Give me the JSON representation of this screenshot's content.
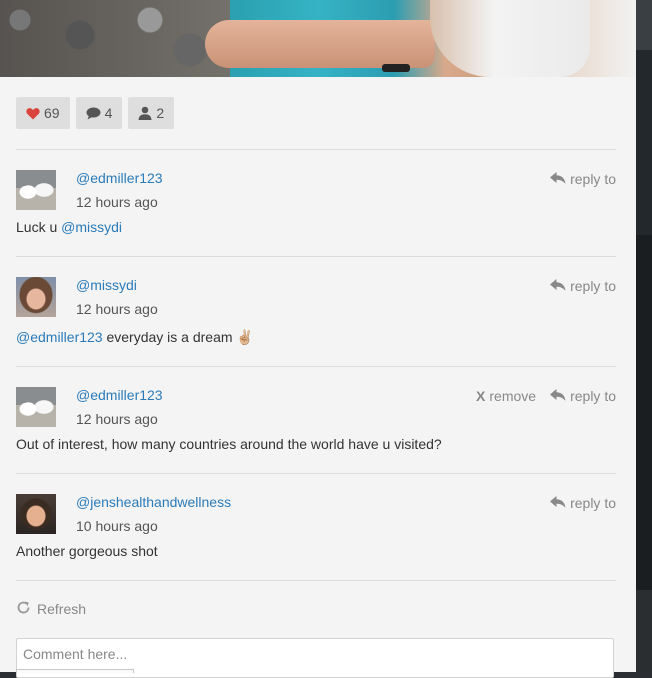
{
  "stats": {
    "likes": "69",
    "comments": "4",
    "followers": "2",
    "heart_color": "#d9443c"
  },
  "comments": [
    {
      "username": "@edmiller123",
      "time": "12 hours ago",
      "text_before": "Luck u ",
      "mention": "@missydi",
      "text_after": "",
      "reply_label": "reply to",
      "avatar": "dogs-avatar"
    },
    {
      "username": "@missydi",
      "time": "12 hours ago",
      "mention": "@edmiller123",
      "text_after": " everyday is a dream ✌🏼",
      "reply_label": "reply to",
      "avatar": "woman-avatar"
    },
    {
      "username": "@edmiller123",
      "time": "12 hours ago",
      "text": "Out of interest, how many countries around the world have u visited?",
      "remove_label": "remove",
      "reply_label": "reply to",
      "avatar": "dogs-avatar"
    },
    {
      "username": "@jenshealthandwellness",
      "time": "10 hours ago",
      "text": "Another gorgeous shot",
      "reply_label": "reply to",
      "avatar": "woman-avatar"
    }
  ],
  "refresh_label": "Refresh",
  "comment_input": {
    "placeholder": "Comment here...",
    "value": ""
  },
  "colors": {
    "link": "#2b7bb9",
    "panel_bg": "#f4f4f4"
  }
}
